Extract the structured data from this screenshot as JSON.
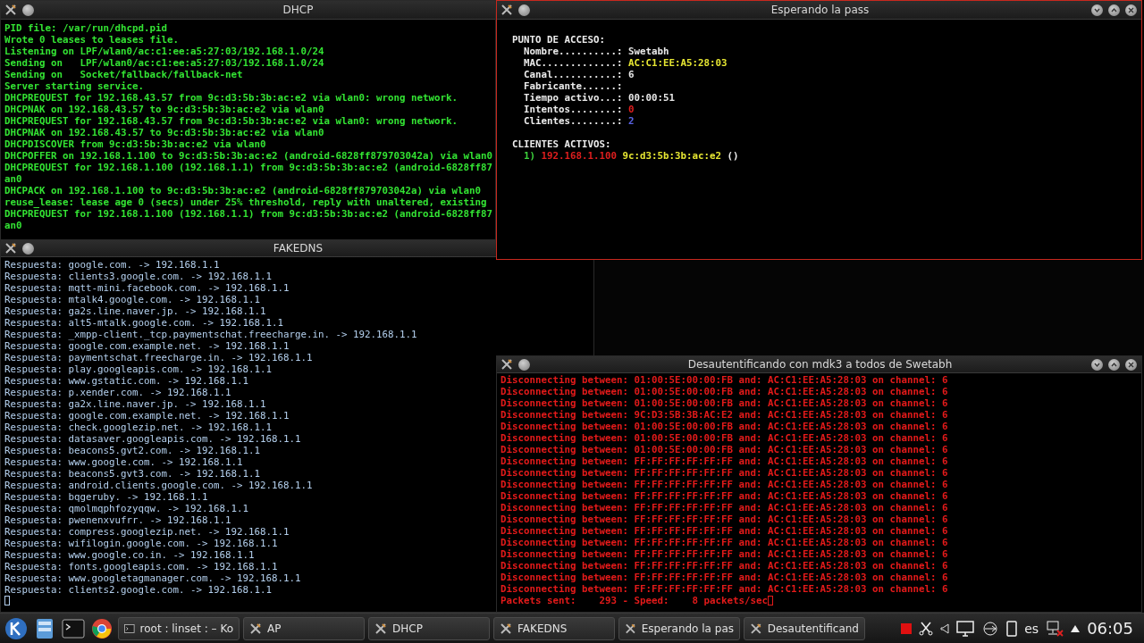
{
  "dhcp_window": {
    "title": "DHCP",
    "focused": false,
    "lines": [
      "PID file: /var/run/dhcpd.pid",
      "Wrote 0 leases to leases file.",
      "Listening on LPF/wlan0/ac:c1:ee:a5:27:03/192.168.1.0/24",
      "Sending on   LPF/wlan0/ac:c1:ee:a5:27:03/192.168.1.0/24",
      "Sending on   Socket/fallback/fallback-net",
      "Server starting service.",
      "DHCPREQUEST for 192.168.43.57 from 9c:d3:5b:3b:ac:e2 via wlan0: wrong network.",
      "DHCPNAK on 192.168.43.57 to 9c:d3:5b:3b:ac:e2 via wlan0",
      "DHCPREQUEST for 192.168.43.57 from 9c:d3:5b:3b:ac:e2 via wlan0: wrong network.",
      "DHCPNAK on 192.168.43.57 to 9c:d3:5b:3b:ac:e2 via wlan0",
      "DHCPDISCOVER from 9c:d3:5b:3b:ac:e2 via wlan0",
      "DHCPOFFER on 192.168.1.100 to 9c:d3:5b:3b:ac:e2 (android-6828ff879703042a) via wlan0",
      "DHCPREQUEST for 192.168.1.100 (192.168.1.1) from 9c:d3:5b:3b:ac:e2 (android-6828ff87",
      "an0",
      "DHCPACK on 192.168.1.100 to 9c:d3:5b:3b:ac:e2 (android-6828ff879703042a) via wlan0",
      "reuse_lease: lease age 0 (secs) under 25% threshold, reply with unaltered, existing",
      "DHCPREQUEST for 192.168.1.100 (192.168.1.1) from 9c:d3:5b:3b:ac:e2 (android-6828ff87",
      "an0"
    ]
  },
  "fakedns_window": {
    "title": "FAKEDNS",
    "focused": false,
    "lines": [
      "Respuesta: google.com. -> 192.168.1.1",
      "Respuesta: clients3.google.com. -> 192.168.1.1",
      "Respuesta: mqtt-mini.facebook.com. -> 192.168.1.1",
      "Respuesta: mtalk4.google.com. -> 192.168.1.1",
      "Respuesta: ga2s.line.naver.jp. -> 192.168.1.1",
      "Respuesta: alt5-mtalk.google.com. -> 192.168.1.1",
      "Respuesta: _xmpp-client._tcp.paymentschat.freecharge.in. -> 192.168.1.1",
      "Respuesta: google.com.example.net. -> 192.168.1.1",
      "Respuesta: paymentschat.freecharge.in. -> 192.168.1.1",
      "Respuesta: play.googleapis.com. -> 192.168.1.1",
      "Respuesta: www.gstatic.com. -> 192.168.1.1",
      "Respuesta: p.xender.com. -> 192.168.1.1",
      "Respuesta: ga2x.line.naver.jp. -> 192.168.1.1",
      "Respuesta: google.com.example.net. -> 192.168.1.1",
      "Respuesta: check.googlezip.net. -> 192.168.1.1",
      "Respuesta: datasaver.googleapis.com. -> 192.168.1.1",
      "Respuesta: beacons5.gvt2.com. -> 192.168.1.1",
      "Respuesta: www.google.com. -> 192.168.1.1",
      "Respuesta: beacons5.gvt3.com. -> 192.168.1.1",
      "Respuesta: android.clients.google.com. -> 192.168.1.1",
      "Respuesta: bqgeruby. -> 192.168.1.1",
      "Respuesta: qmolmqphfozyqqw. -> 192.168.1.1",
      "Respuesta: pwenenxvufrr. -> 192.168.1.1",
      "Respuesta: compress.googlezip.net. -> 192.168.1.1",
      "Respuesta: wifilogin.google.com. -> 192.168.1.1",
      "Respuesta: www.google.co.in. -> 192.168.1.1",
      "Respuesta: fonts.googleapis.com. -> 192.168.1.1",
      "Respuesta: www.googletagmanager.com. -> 192.168.1.1",
      "Respuesta: clients2.google.com. -> 192.168.1.1"
    ]
  },
  "ap_window": {
    "title": "Esperando la pass",
    "focused": true,
    "heading": "PUNTO DE ACCESO:",
    "fields": [
      {
        "label": "Nombre..........:",
        "value": "Swetabh",
        "color": "#e8e8e8"
      },
      {
        "label": "MAC.............:",
        "value": "AC:C1:EE:A5:28:03",
        "color": "#e6e632"
      },
      {
        "label": "Canal...........:",
        "value": "6",
        "color": "#e8e8e8"
      },
      {
        "label": "Fabricante......:"
      },
      {
        "label": "Tiempo activo...:",
        "value": "00:00:51",
        "color": "#e8e8e8"
      },
      {
        "label": "Intentos........:",
        "value": "0",
        "color": "#e01e1e"
      },
      {
        "label": "Clientes........:",
        "value": "2",
        "color": "#5a64e6"
      }
    ],
    "clients_heading": "CLIENTES ACTIVOS:",
    "clients": [
      {
        "index": "1)",
        "ip": "192.168.1.100",
        "mac": "9c:d3:5b:3b:ac:e2",
        "name": "()"
      }
    ]
  },
  "deauth_window": {
    "title": "Desautentificando con mdk3 a todos de Swetabh",
    "focused": false,
    "lines": [
      "Disconnecting between: 01:00:5E:00:00:FB and: AC:C1:EE:A5:28:03 on channel: 6",
      "Disconnecting between: 01:00:5E:00:00:FB and: AC:C1:EE:A5:28:03 on channel: 6",
      "Disconnecting between: 01:00:5E:00:00:FB and: AC:C1:EE:A5:28:03 on channel: 6",
      "Disconnecting between: 9C:D3:5B:3B:AC:E2 and: AC:C1:EE:A5:28:03 on channel: 6",
      "Disconnecting between: 01:00:5E:00:00:FB and: AC:C1:EE:A5:28:03 on channel: 6",
      "Disconnecting between: 01:00:5E:00:00:FB and: AC:C1:EE:A5:28:03 on channel: 6",
      "Disconnecting between: 01:00:5E:00:00:FB and: AC:C1:EE:A5:28:03 on channel: 6",
      "Disconnecting between: FF:FF:FF:FF:FF:FF and: AC:C1:EE:A5:28:03 on channel: 6",
      "Disconnecting between: FF:FF:FF:FF:FF:FF and: AC:C1:EE:A5:28:03 on channel: 6",
      "Disconnecting between: FF:FF:FF:FF:FF:FF and: AC:C1:EE:A5:28:03 on channel: 6",
      "Disconnecting between: FF:FF:FF:FF:FF:FF and: AC:C1:EE:A5:28:03 on channel: 6",
      "Disconnecting between: FF:FF:FF:FF:FF:FF and: AC:C1:EE:A5:28:03 on channel: 6",
      "Disconnecting between: FF:FF:FF:FF:FF:FF and: AC:C1:EE:A5:28:03 on channel: 6",
      "Disconnecting between: FF:FF:FF:FF:FF:FF and: AC:C1:EE:A5:28:03 on channel: 6",
      "Disconnecting between: FF:FF:FF:FF:FF:FF and: AC:C1:EE:A5:28:03 on channel: 6",
      "Disconnecting between: FF:FF:FF:FF:FF:FF and: AC:C1:EE:A5:28:03 on channel: 6",
      "Disconnecting between: FF:FF:FF:FF:FF:FF and: AC:C1:EE:A5:28:03 on channel: 6",
      "Disconnecting between: FF:FF:FF:FF:FF:FF and: AC:C1:EE:A5:28:03 on channel: 6",
      "Disconnecting between: FF:FF:FF:FF:FF:FF and: AC:C1:EE:A5:28:03 on channel: 6"
    ],
    "footer": "Packets sent:    293 - Speed:    8 packets/sec"
  },
  "taskbar": {
    "tasks": [
      {
        "kind": "terminal",
        "label": "root : linset : – Ko"
      },
      {
        "kind": "app",
        "label": "AP"
      },
      {
        "kind": "app",
        "label": "DHCP"
      },
      {
        "kind": "app",
        "label": "FAKEDNS"
      },
      {
        "kind": "app",
        "label": "Esperando la pas"
      },
      {
        "kind": "app",
        "label": "Desautentificand"
      }
    ],
    "language": "es",
    "clock": "06:05"
  }
}
